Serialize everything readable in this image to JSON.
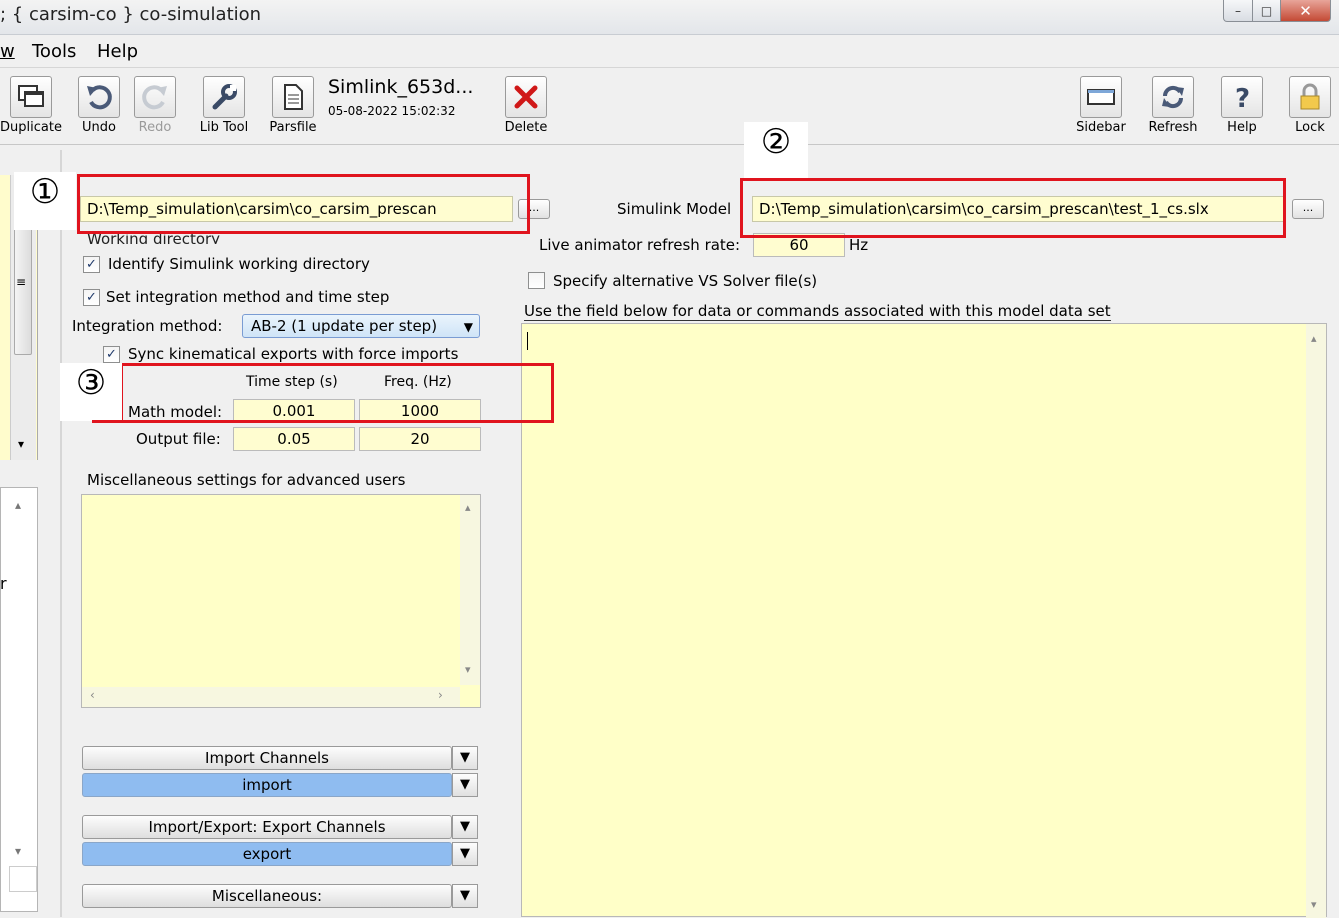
{
  "window": {
    "title": "; { carsim-co } co-simulation",
    "min_glyph": "–",
    "max_glyph": "□",
    "close_glyph": "✕"
  },
  "menu": [
    {
      "label": "w"
    },
    {
      "label": "Tools"
    },
    {
      "label": "Help"
    }
  ],
  "toolbar": {
    "duplicate": "Duplicate",
    "undo": "Undo",
    "redo": "Redo",
    "lib_tool": "Lib Tool",
    "parsfile": "Parsfile",
    "parsfile_title": "Simlink_653d...",
    "parsfile_date": "05-08-2022 15:02:32",
    "delete": "Delete",
    "sidebar": "Sidebar",
    "refresh": "Refresh",
    "help": "Help",
    "lock": "Lock"
  },
  "left": {
    "working_dir_path": "D:\\Temp_simulation\\carsim\\co_carsim_prescan",
    "browse_label": "...",
    "working_dir_caption": "Working directory",
    "identify_label": "Identify Simulink working directory",
    "identify_checked": true,
    "set_integration_label": "Set integration method and time step",
    "set_integration_checked": true,
    "integration_method_label": "Integration method:",
    "integration_method_value": "AB-2 (1 update per step)",
    "sync_label": "Sync kinematical exports with force imports",
    "sync_checked": true,
    "col_time_step": "Time step (s)",
    "col_freq": "Freq. (Hz)",
    "math_model_label": "Math model:",
    "math_model_time_step": "0.001",
    "math_model_freq": "1000",
    "output_file_label": "Output file:",
    "output_file_time_step": "0.05",
    "output_file_freq": "20",
    "misc_caption": "Miscellaneous settings for advanced users",
    "import_channels_label": "Import Channels",
    "import_value": "import",
    "export_channels_label": "Import/Export: Export Channels",
    "export_value": "export",
    "misc_button_label": "Miscellaneous:"
  },
  "right": {
    "simulink_model_label": "Simulink Model",
    "simulink_model_path": "D:\\Temp_simulation\\carsim\\co_carsim_prescan\\test_1_cs.slx",
    "browse_label": "...",
    "refresh_rate_label": "Live animator refresh rate:",
    "refresh_rate_value": "60",
    "refresh_rate_unit": "Hz",
    "alt_solver_label": "Specify alternative VS Solver file(s)",
    "alt_solver_checked": false,
    "field_caption": "Use the field below  for data or commands associated with this model data set"
  },
  "annotations": {
    "one": "①",
    "two": "②",
    "three": "③",
    "color": "#e0141e"
  },
  "glyphs": {
    "check": "✓",
    "dropdown_arrow": "▼",
    "scroll_up": "▴",
    "scroll_down": "▾",
    "scroll_left": "‹",
    "scroll_right": "›",
    "grip": "≡"
  },
  "left_strip_letter": "r"
}
